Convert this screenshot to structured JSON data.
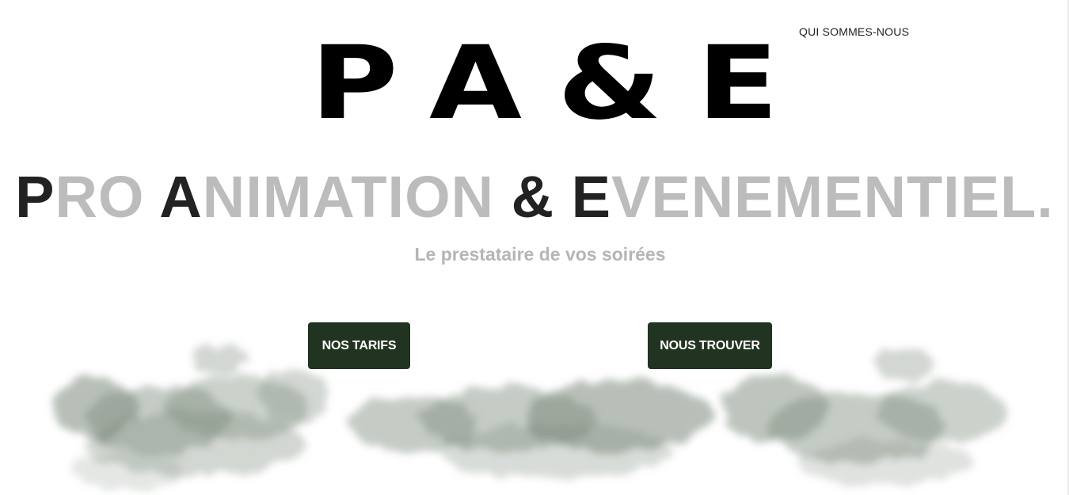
{
  "nav": {
    "about_label": "QUI SOMMES-NOUS"
  },
  "logo": {
    "letters": [
      "P",
      "A",
      "&",
      "E"
    ]
  },
  "hero": {
    "headline_parts": [
      {
        "initial": "P",
        "rest": "RO "
      },
      {
        "initial": "A",
        "rest": "NIMATION "
      },
      {
        "initial": "& E",
        "rest": "VENEMENTIEL."
      }
    ],
    "subtitle": "Le prestataire de vos soirées"
  },
  "buttons": {
    "tarifs_label": "NOS TARIFS",
    "trouver_label": "NOUS TROUVER"
  },
  "decor": {
    "cloud_color": "#7e8b7e",
    "button_color": "#213421",
    "headline_accent": "#222222",
    "headline_muted": "#bcbcbc"
  }
}
